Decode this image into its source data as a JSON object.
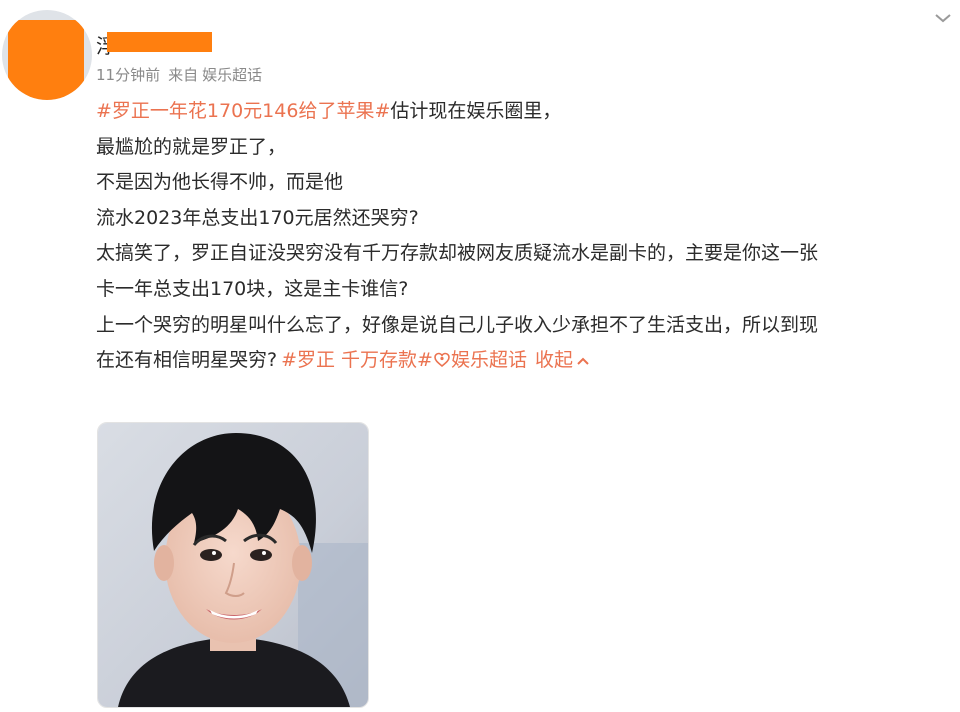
{
  "post": {
    "author": {
      "name_prefix": "浮"
    },
    "meta": {
      "time": "11分钟前",
      "from": "来自",
      "source": "娱乐超话"
    },
    "lines": {
      "l1_topic": "#罗正一年花170元146给了苹果#",
      "l1_text": "估计现在娱乐圈里，",
      "l2": "最尴尬的就是罗正了，",
      "l3": "不是因为他长得不帅，而是他",
      "l4": "流水2023年总支出170元居然还哭穷?",
      "l5": "太搞笑了，罗正自证没哭穷没有千万存款却被网友质疑流水是副卡的，主要是你这一张",
      "l6": "卡一年总支出170块，这是主卡谁信?",
      "l7": "上一个哭穷的明星叫什么忘了，好像是说自己儿子收入少承担不了生活支出，所以到现",
      "l8_text": "在还有相信明星哭穷?",
      "l8_topic": "#罗正 千万存款#",
      "l8_supertopic": "娱乐超话",
      "l8_collapse": "收起"
    },
    "icons": {
      "more": "chevron-down-icon",
      "supertopic": "supertopic-icon",
      "collapse": "chevron-up-icon"
    },
    "colors": {
      "link": "#eb7350",
      "redaction": "#ff7f0f",
      "meta": "#8a8a8a"
    }
  }
}
